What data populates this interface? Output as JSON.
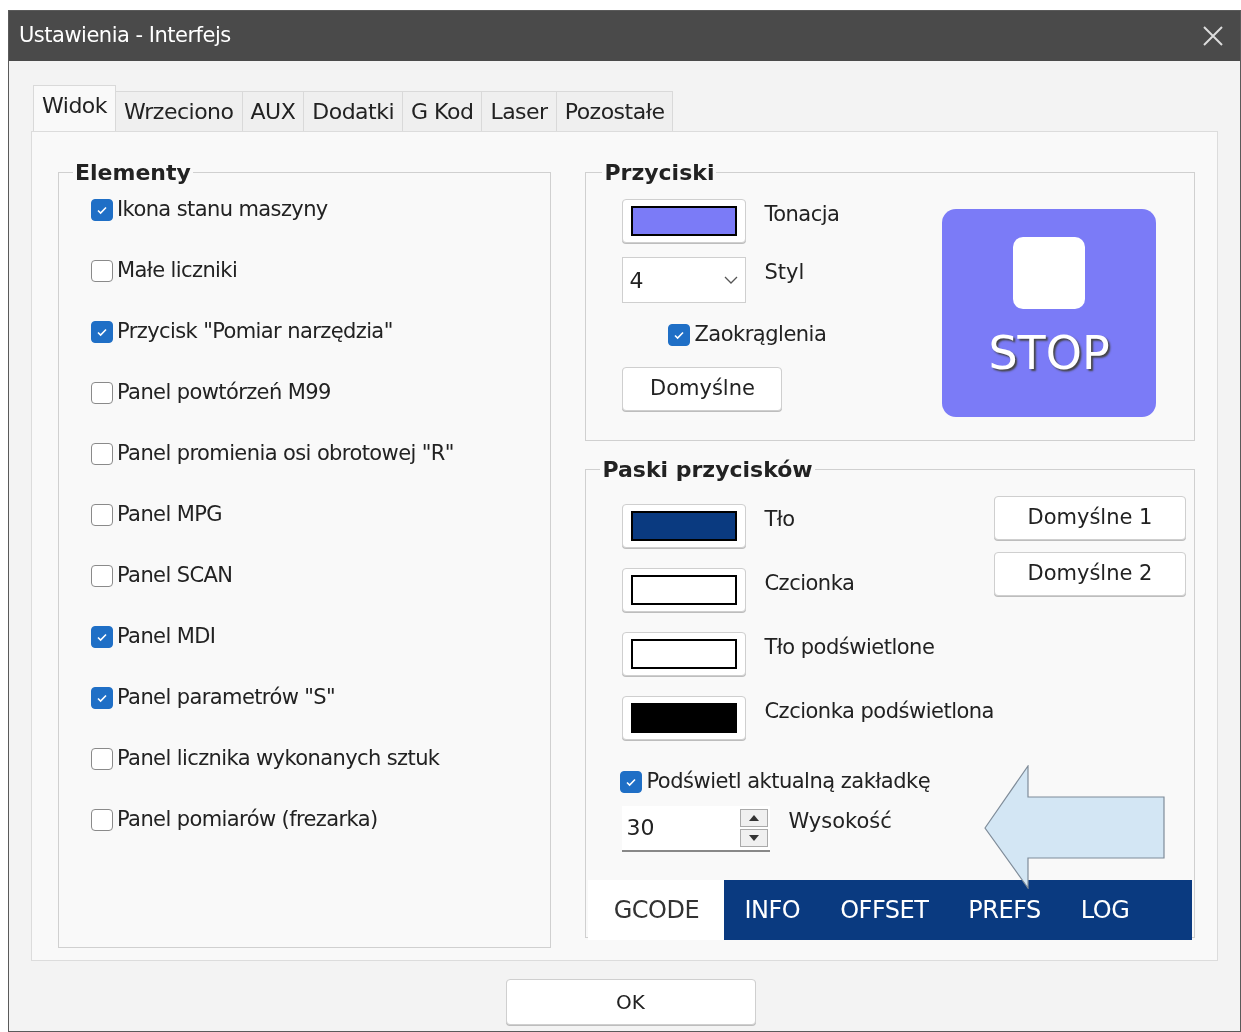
{
  "window": {
    "title": "Ustawienia - Interfejs"
  },
  "tabs": [
    {
      "label": "Widok",
      "selected": true
    },
    {
      "label": "Wrzeciono",
      "selected": false
    },
    {
      "label": "AUX",
      "selected": false
    },
    {
      "label": "Dodatki",
      "selected": false
    },
    {
      "label": "G Kod",
      "selected": false
    },
    {
      "label": "Laser",
      "selected": false
    },
    {
      "label": "Pozostałe",
      "selected": false
    }
  ],
  "elements": {
    "title": "Elementy",
    "items": [
      {
        "label": "Ikona stanu maszyny",
        "checked": true
      },
      {
        "label": "Małe liczniki",
        "checked": false
      },
      {
        "label": "Przycisk \"Pomiar narzędzia\"",
        "checked": true
      },
      {
        "label": "Panel powtórzeń M99",
        "checked": false
      },
      {
        "label": "Panel promienia osi obrotowej \"R\"",
        "checked": false
      },
      {
        "label": "Panel MPG",
        "checked": false
      },
      {
        "label": "Panel SCAN",
        "checked": false
      },
      {
        "label": "Panel MDI",
        "checked": true
      },
      {
        "label": "Panel parametrów \"S\"",
        "checked": true
      },
      {
        "label": "Panel licznika wykonanych sztuk",
        "checked": false
      },
      {
        "label": "Panel pomiarów (frezarka)",
        "checked": false
      }
    ]
  },
  "buttons_group": {
    "title": "Przyciski",
    "tone": {
      "label": "Tonacja",
      "color": "#7b7bf7"
    },
    "style": {
      "value": "4",
      "label": "Styl"
    },
    "rounded": {
      "label": "Zaokrąglenia",
      "checked": true
    },
    "default_button": "Domyślne",
    "preview": {
      "label": "STOP"
    }
  },
  "bars_group": {
    "title": "Paski przycisków",
    "colors": [
      {
        "label": "Tło",
        "color": "#0a3a80"
      },
      {
        "label": "Czcionka",
        "color": "#ffffff"
      },
      {
        "label": "Tło podświetlone",
        "color": "#ffffff"
      },
      {
        "label": "Czcionka podświetlona",
        "color": "#000000"
      }
    ],
    "default_buttons": [
      "Domyślne 1",
      "Domyślne 2"
    ],
    "highlight": {
      "label": "Podświetl aktualną zakładkę",
      "checked": true
    },
    "height": {
      "value": "30",
      "label": "Wysokość"
    },
    "preview_tabs": [
      {
        "label": "GCODE",
        "selected": true
      },
      {
        "label": "INFO",
        "selected": false
      },
      {
        "label": "OFFSET",
        "selected": false
      },
      {
        "label": "PREFS",
        "selected": false
      },
      {
        "label": "LOG",
        "selected": false
      }
    ]
  },
  "ok_button": "OK"
}
